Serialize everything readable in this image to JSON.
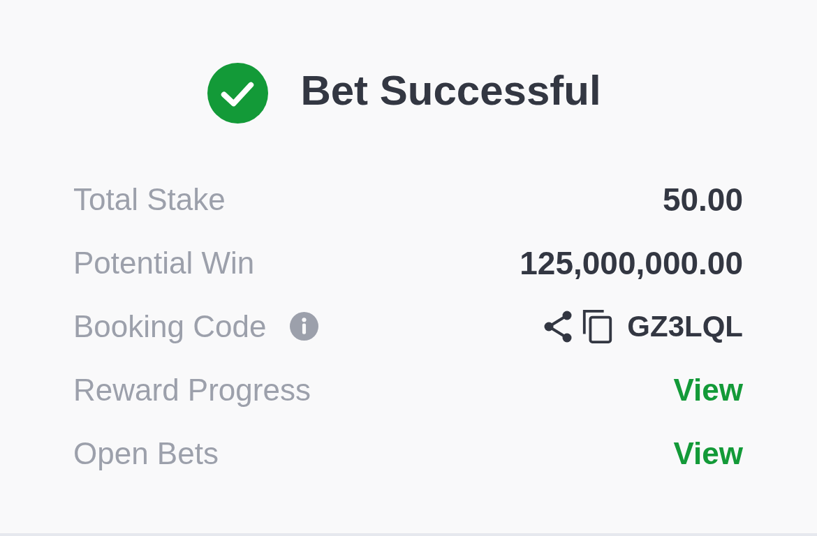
{
  "header": {
    "title": "Bet Successful"
  },
  "rows": [
    {
      "label": "Total Stake",
      "info": false,
      "kind": "amount",
      "value": "50.00"
    },
    {
      "label": "Potential Win",
      "info": false,
      "kind": "amount",
      "value": "125,000,000.00"
    },
    {
      "label": "Booking Code",
      "info": true,
      "kind": "code",
      "value": "GZ3LQL"
    },
    {
      "label": "Reward Progress",
      "info": false,
      "kind": "link",
      "value": "View"
    },
    {
      "label": "Open Bets",
      "info": false,
      "kind": "link",
      "value": "View"
    }
  ]
}
